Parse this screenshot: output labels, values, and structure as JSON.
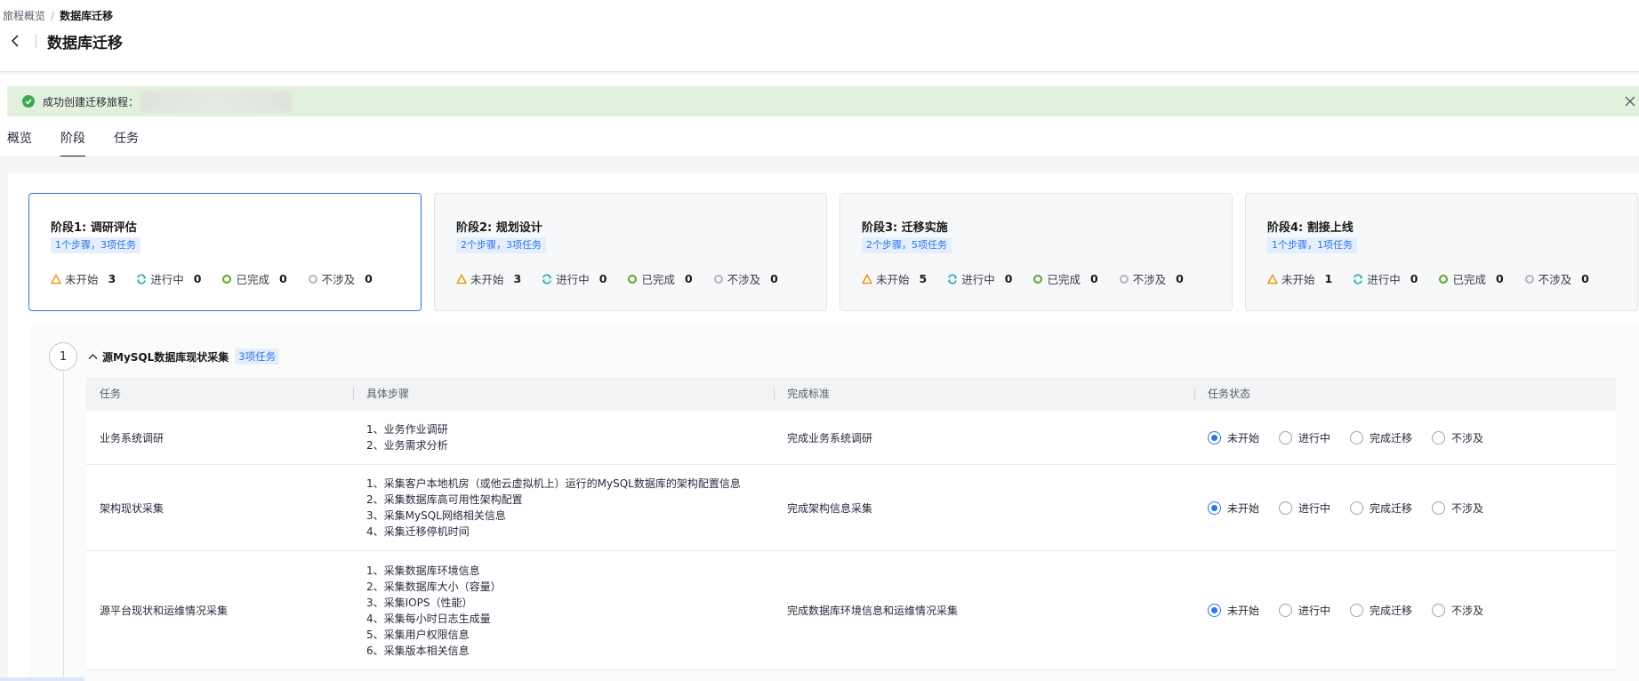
{
  "breadcrumb": {
    "parent": "旅程概览",
    "separator": "/",
    "current": "数据库迁移"
  },
  "header": {
    "title": "数据库迁移"
  },
  "banner": {
    "message": "成功创建迁移旅程："
  },
  "tabs": [
    {
      "label": "概览",
      "active": false
    },
    {
      "label": "阶段",
      "active": true
    },
    {
      "label": "任务",
      "active": false
    }
  ],
  "stages": [
    {
      "title": "阶段1: 调研评估",
      "tag": "1个步骤，3项任务",
      "active": true,
      "stats": [
        {
          "label": "未开始",
          "value": "3",
          "icon": "warning-triangle-icon"
        },
        {
          "label": "进行中",
          "value": "0",
          "icon": "sync-icon"
        },
        {
          "label": "已完成",
          "value": "0",
          "icon": "complete-circle-icon"
        },
        {
          "label": "不涉及",
          "value": "0",
          "icon": "na-circle-icon"
        }
      ]
    },
    {
      "title": "阶段2: 规划设计",
      "tag": "2个步骤，3项任务",
      "active": false,
      "stats": [
        {
          "label": "未开始",
          "value": "3",
          "icon": "warning-triangle-icon"
        },
        {
          "label": "进行中",
          "value": "0",
          "icon": "sync-icon"
        },
        {
          "label": "已完成",
          "value": "0",
          "icon": "complete-circle-icon"
        },
        {
          "label": "不涉及",
          "value": "0",
          "icon": "na-circle-icon"
        }
      ]
    },
    {
      "title": "阶段3: 迁移实施",
      "tag": "2个步骤，5项任务",
      "active": false,
      "stats": [
        {
          "label": "未开始",
          "value": "5",
          "icon": "warning-triangle-icon"
        },
        {
          "label": "进行中",
          "value": "0",
          "icon": "sync-icon"
        },
        {
          "label": "已完成",
          "value": "0",
          "icon": "complete-circle-icon"
        },
        {
          "label": "不涉及",
          "value": "0",
          "icon": "na-circle-icon"
        }
      ]
    },
    {
      "title": "阶段4: 割接上线",
      "tag": "1个步骤，1项任务",
      "active": false,
      "stats": [
        {
          "label": "未开始",
          "value": "1",
          "icon": "warning-triangle-icon"
        },
        {
          "label": "进行中",
          "value": "0",
          "icon": "sync-icon"
        },
        {
          "label": "已完成",
          "value": "0",
          "icon": "complete-circle-icon"
        },
        {
          "label": "不涉及",
          "value": "0",
          "icon": "na-circle-icon"
        }
      ]
    }
  ],
  "step": {
    "number": "1",
    "name": "源MySQL数据库现状采集",
    "count": "3项任务",
    "columns": [
      "任务",
      "具体步骤",
      "完成标准",
      "任务状态"
    ],
    "status_options": [
      "未开始",
      "进行中",
      "完成迁移",
      "不涉及"
    ],
    "rows": [
      {
        "task": "业务系统调研",
        "steps": [
          "1、业务作业调研",
          "2、业务需求分析"
        ],
        "standard": "完成业务系统调研",
        "status": 0
      },
      {
        "task": "架构现状采集",
        "steps": [
          "1、采集客户本地机房（或他云虚拟机上）运行的MySQL数据库的架构配置信息",
          "2、采集数据库高可用性架构配置",
          "3、采集MySQL网络相关信息",
          "4、采集迁移停机时间"
        ],
        "standard": "完成架构信息采集",
        "status": 0
      },
      {
        "task": "源平台现状和运维情况采集",
        "steps": [
          "1、采集数据库环境信息",
          "2、采集数据库大小（容量）",
          "3、采集IOPS（性能）",
          "4、采集每小时日志生成量",
          "5、采集用户权限信息",
          "6、采集版本相关信息"
        ],
        "standard": "完成数据库环境信息和运维情况采集",
        "status": 0
      }
    ]
  },
  "colors": {
    "accent": "#2f76e6",
    "success": "#3fa84e",
    "warning": "#f58b00",
    "progress": "#1aa8b3"
  }
}
